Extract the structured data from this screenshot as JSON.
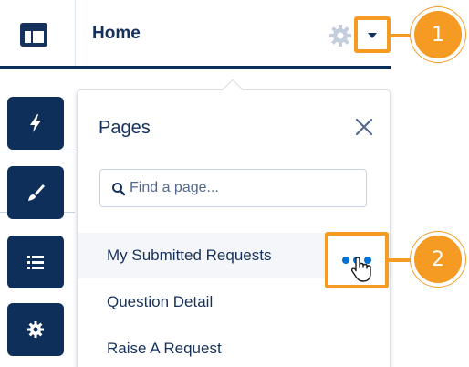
{
  "header": {
    "title": "Home",
    "icons": {
      "layout": "layout-icon",
      "settings": "gear-icon",
      "dropdown": "dropdown-arrow-icon"
    }
  },
  "toolbar": {
    "items": [
      {
        "icon": "lightning-icon"
      },
      {
        "icon": "brush-icon"
      },
      {
        "icon": "list-icon"
      },
      {
        "icon": "gear-icon"
      }
    ]
  },
  "pages_panel": {
    "title": "Pages",
    "search": {
      "value": "",
      "placeholder": "Find a page..."
    },
    "items": [
      {
        "label": "My Submitted Requests",
        "selected": true
      },
      {
        "label": "Question Detail",
        "selected": false
      },
      {
        "label": "Raise A Request",
        "selected": false
      }
    ]
  },
  "callouts": [
    "1",
    "2"
  ],
  "colors": {
    "navy": "#0f2f5b",
    "accent": "#f59a23",
    "link_blue": "#0070d2",
    "text": "#16325c"
  }
}
